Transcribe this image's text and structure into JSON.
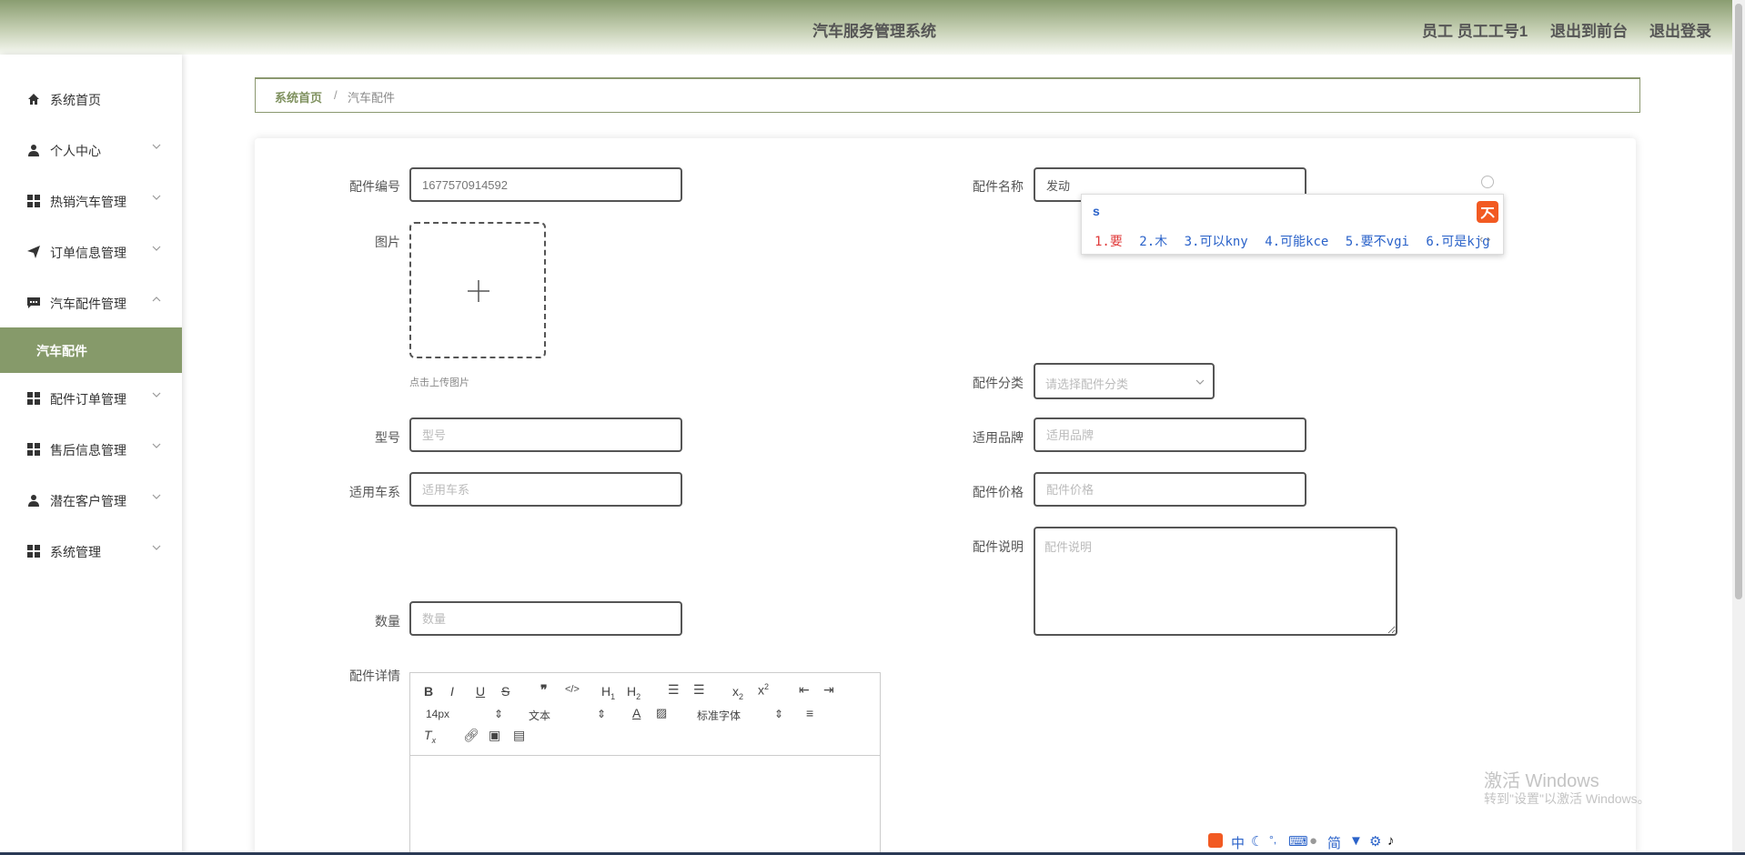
{
  "header": {
    "title": "汽车服务管理系统",
    "user": "员工 员工工号1",
    "back_to_front": "退出到前台",
    "logout": "退出登录"
  },
  "sidebar": {
    "items": [
      {
        "label": "系统首页",
        "icon": "home-icon"
      },
      {
        "label": "个人中心",
        "icon": "user-icon"
      },
      {
        "label": "热销汽车管理",
        "icon": "grid-icon"
      },
      {
        "label": "订单信息管理",
        "icon": "send-icon"
      },
      {
        "label": "汽车配件管理",
        "icon": "chat-icon"
      },
      {
        "label": "配件订单管理",
        "icon": "grid-icon"
      },
      {
        "label": "售后信息管理",
        "icon": "grid-icon"
      },
      {
        "label": "潜在客户管理",
        "icon": "user-icon"
      },
      {
        "label": "系统管理",
        "icon": "grid-icon"
      }
    ],
    "active_sub": "汽车配件"
  },
  "breadcrumb": {
    "home": "系统首页",
    "separator": "/",
    "current": "汽车配件"
  },
  "form": {
    "part_no_label": "配件编号",
    "part_no_value": "1677570914592",
    "part_name_label": "配件名称",
    "part_name_value": "发动",
    "image_label": "图片",
    "upload_hint": "点击上传图片",
    "category_label": "配件分类",
    "category_placeholder": "请选择配件分类",
    "model_label": "型号",
    "model_placeholder": "型号",
    "brand_label": "适用品牌",
    "brand_placeholder": "适用品牌",
    "series_label": "适用车系",
    "series_placeholder": "适用车系",
    "price_label": "配件价格",
    "price_placeholder": "配件价格",
    "desc_label": "配件说明",
    "desc_placeholder": "配件说明",
    "qty_label": "数量",
    "qty_placeholder": "数量",
    "detail_label": "配件详情"
  },
  "editor": {
    "font_size": "14px",
    "block_type": "文本",
    "font_family": "标准字体"
  },
  "ime": {
    "composition": "s",
    "candidates": [
      {
        "num": "1.",
        "text": "要"
      },
      {
        "num": "2.",
        "text": "木"
      },
      {
        "num": "3.",
        "text": "可以kny"
      },
      {
        "num": "4.",
        "text": "可能kce"
      },
      {
        "num": "5.",
        "text": "要不vgi"
      },
      {
        "num": "6.",
        "text": "可是kjg"
      }
    ],
    "status_bar": [
      "中",
      "简"
    ]
  },
  "watermark": {
    "line1": "激活 Windows",
    "line2": "转到\"设置\"以激活 Windows。"
  },
  "colors": {
    "accent": "#869a6a",
    "header_gradient_top": "#8a9d71"
  }
}
